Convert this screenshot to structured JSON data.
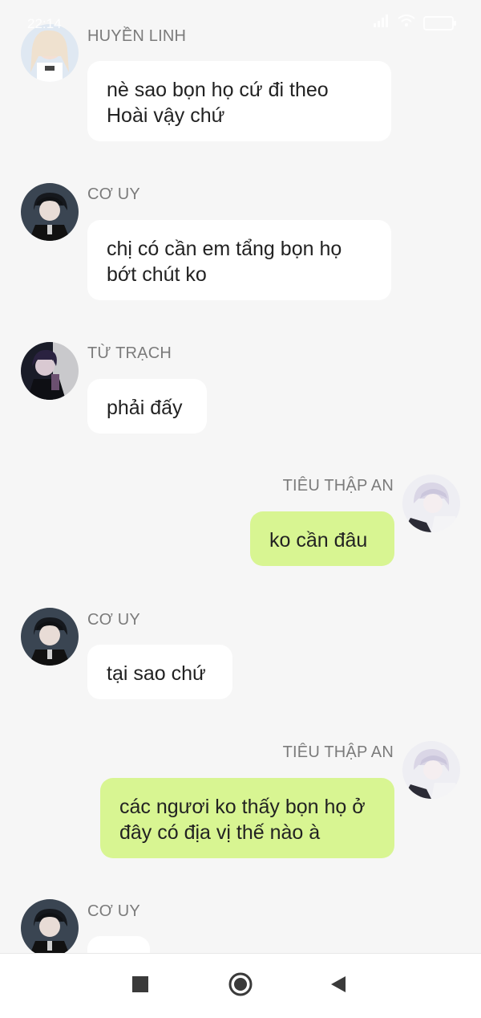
{
  "status_bar": {
    "time": "22:14"
  },
  "messages": [
    {
      "side": "left",
      "sender": "HUYỀN LINH",
      "text": "nè sao bọn họ cứ đi theo Hoài vậy chứ"
    },
    {
      "side": "left",
      "sender": "CƠ UY",
      "text": "chị có cần em tẩng bọn họ bớt chút ko"
    },
    {
      "side": "left",
      "sender": "TỪ TRẠCH",
      "text": "phải đấy"
    },
    {
      "side": "right",
      "sender": "TIÊU THẬP AN",
      "text": "ko cần đâu"
    },
    {
      "side": "left",
      "sender": "CƠ UY",
      "text": "tại sao chứ"
    },
    {
      "side": "right",
      "sender": "TIÊU THẬP AN",
      "text": "các ngươi ko thấy bọn họ ở đây có địa vị thế nào à"
    },
    {
      "side": "left",
      "sender": "CƠ UY",
      "text": ""
    }
  ],
  "colors": {
    "my_bubble": "#d8f592",
    "other_bubble": "#ffffff",
    "background": "#f6f6f6",
    "sender_name": "#7b7b7b"
  },
  "nav": {
    "icons": [
      "recents-square-icon",
      "home-circle-icon",
      "back-triangle-icon"
    ]
  }
}
